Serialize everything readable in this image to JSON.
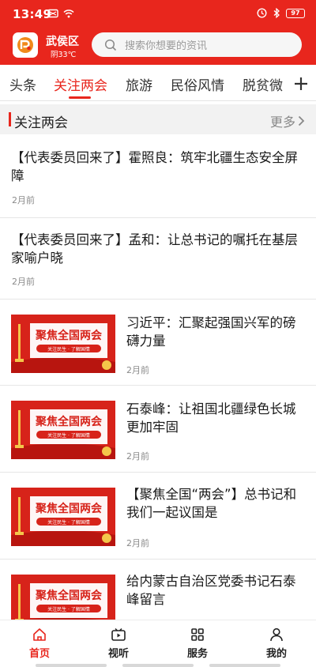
{
  "status_bar": {
    "time": "13:49",
    "battery": "97"
  },
  "header": {
    "location": "武侯区",
    "weather": "阴33℃",
    "search_placeholder": "搜索你想要的资讯",
    "accent_color": "#e8261d"
  },
  "tabs": [
    {
      "label": "头条",
      "active": false
    },
    {
      "label": "关注两会",
      "active": true
    },
    {
      "label": "旅游",
      "active": false
    },
    {
      "label": "民俗风情",
      "active": false
    },
    {
      "label": "脱贫微",
      "active": false
    }
  ],
  "section": {
    "title": "关注两会",
    "more_label": "更多"
  },
  "articles": [
    {
      "title": "【代表委员回来了】霍照良：筑牢北疆生态安全屏障",
      "time": "2月前",
      "has_image": false
    },
    {
      "title": "【代表委员回来了】孟和：让总书记的嘱托在基层家喻户晓",
      "time": "2月前",
      "has_image": false
    },
    {
      "title": "习近平：汇聚起强国兴军的磅礴力量",
      "time": "2月前",
      "has_image": true
    },
    {
      "title": "石泰峰：让祖国北疆绿色长城更加牢固",
      "time": "2月前",
      "has_image": true
    },
    {
      "title": "【聚焦全国“两会”】总书记和我们一起议国是",
      "time": "2月前",
      "has_image": true
    },
    {
      "title": "给内蒙古自治区党委书记石泰峰留言",
      "time": "",
      "has_image": true
    }
  ],
  "thumbnail": {
    "headline": "聚焦全国两会",
    "subline": "关注民生 · 了解国情"
  },
  "bottom_nav": [
    {
      "label": "首页",
      "icon": "home-icon",
      "active": true
    },
    {
      "label": "视听",
      "icon": "video-icon",
      "active": false
    },
    {
      "label": "服务",
      "icon": "grid-icon",
      "active": false
    },
    {
      "label": "我的",
      "icon": "user-icon",
      "active": false
    }
  ]
}
